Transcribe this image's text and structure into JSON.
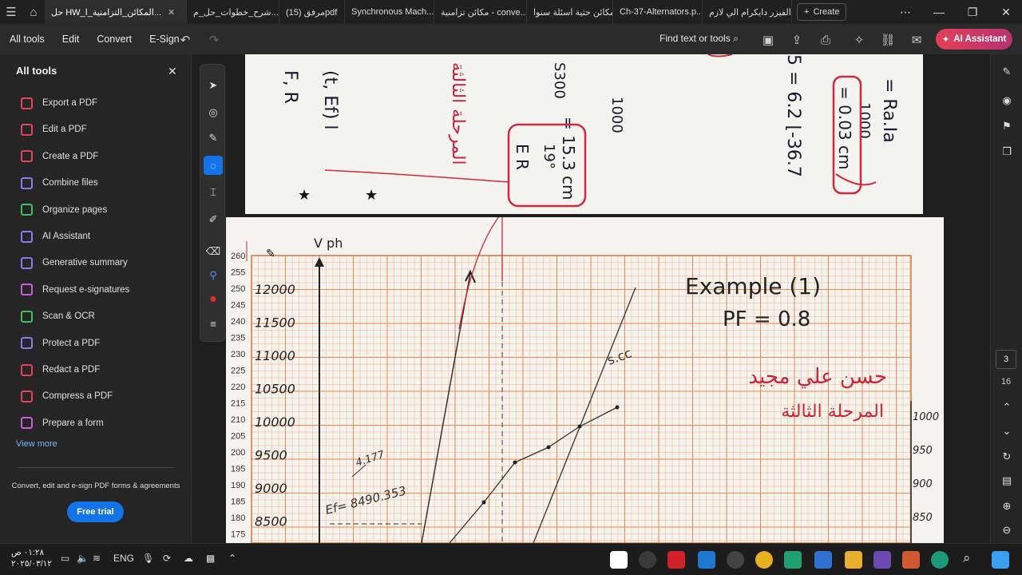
{
  "tabs": [
    {
      "label": "حل HW_المكائن_التزامنية_ا...",
      "active": true
    },
    {
      "label": "شرح_خطوات_حل_م...",
      "active": false
    },
    {
      "label": "مرفق (15)pdf",
      "active": false
    },
    {
      "label": "Synchronous Mach...",
      "active": false
    },
    {
      "label": "مكائن تزامنية - conve...",
      "active": false
    },
    {
      "label": "مكائن حثية اسئلة سنوا...",
      "active": false
    },
    {
      "label": "Ch-37-Alternators.p...",
      "active": false
    },
    {
      "label": "الفيزر دايكرام الي لازم...",
      "active": false
    }
  ],
  "create_label": "Create",
  "menu": {
    "all_tools": "All tools",
    "edit": "Edit",
    "convert": "Convert",
    "esign": "E-Sign"
  },
  "find_label": "Find text or tools",
  "ai_assistant_label": "AI Assistant",
  "sidebar": {
    "title": "All tools",
    "items": [
      {
        "label": "Export a PDF",
        "color": "#e0455a"
      },
      {
        "label": "Edit a PDF",
        "color": "#e0455a"
      },
      {
        "label": "Create a PDF",
        "color": "#e0455a"
      },
      {
        "label": "Combine files",
        "color": "#8a7cf0"
      },
      {
        "label": "Organize pages",
        "color": "#3fbf5f"
      },
      {
        "label": "AI Assistant",
        "color": "#8a7cf0"
      },
      {
        "label": "Generative summary",
        "color": "#8a7cf0"
      },
      {
        "label": "Request e-signatures",
        "color": "#c85fd6"
      },
      {
        "label": "Scan & OCR",
        "color": "#3fbf5f"
      },
      {
        "label": "Protect a PDF",
        "color": "#8a7cf0"
      },
      {
        "label": "Redact a PDF",
        "color": "#e0455a"
      },
      {
        "label": "Compress a PDF",
        "color": "#e0455a"
      },
      {
        "label": "Prepare a form",
        "color": "#c85fd6"
      }
    ],
    "view_more": "View more",
    "promo": "Convert, edit and e-sign PDF forms & agreements",
    "trial": "Free trial"
  },
  "page_current": "3",
  "page_total": "16",
  "document": {
    "page1_texts": [
      "Ra.Ia",
      "1000",
      "= 0.03 cm",
      "5 = 6.2 ⌊-36.7",
      "S300",
      "1000",
      "= 15.3 cm",
      "19°",
      "E R",
      "★",
      "★"
    ],
    "graph": {
      "yaxis_label": "V ph",
      "left_ticks": [
        "260",
        "255",
        "250",
        "245",
        "240",
        "235",
        "230",
        "225",
        "220",
        "215",
        "210",
        "205",
        "200",
        "195",
        "190",
        "185",
        "180",
        "175"
      ],
      "handwritten_y": [
        "12000",
        "11500",
        "11000",
        "10500",
        "10000",
        "9500",
        "9000",
        "8500"
      ],
      "right_ticks": [
        "1000",
        "950",
        "900",
        "850"
      ],
      "title": "Example (1)",
      "pf": "PF = 0.8",
      "ar_name": "حسن علي مجيد",
      "ar_stage": "المرحلة الثالثة",
      "scc": "s.cc",
      "ef": "Ef= 8490.353",
      "ratio": "4.177"
    }
  },
  "taskbar": {
    "time": "٠١:٢٨ ص",
    "date": "٢٠٢٥/٠٣/١٢",
    "lang": "ENG"
  }
}
